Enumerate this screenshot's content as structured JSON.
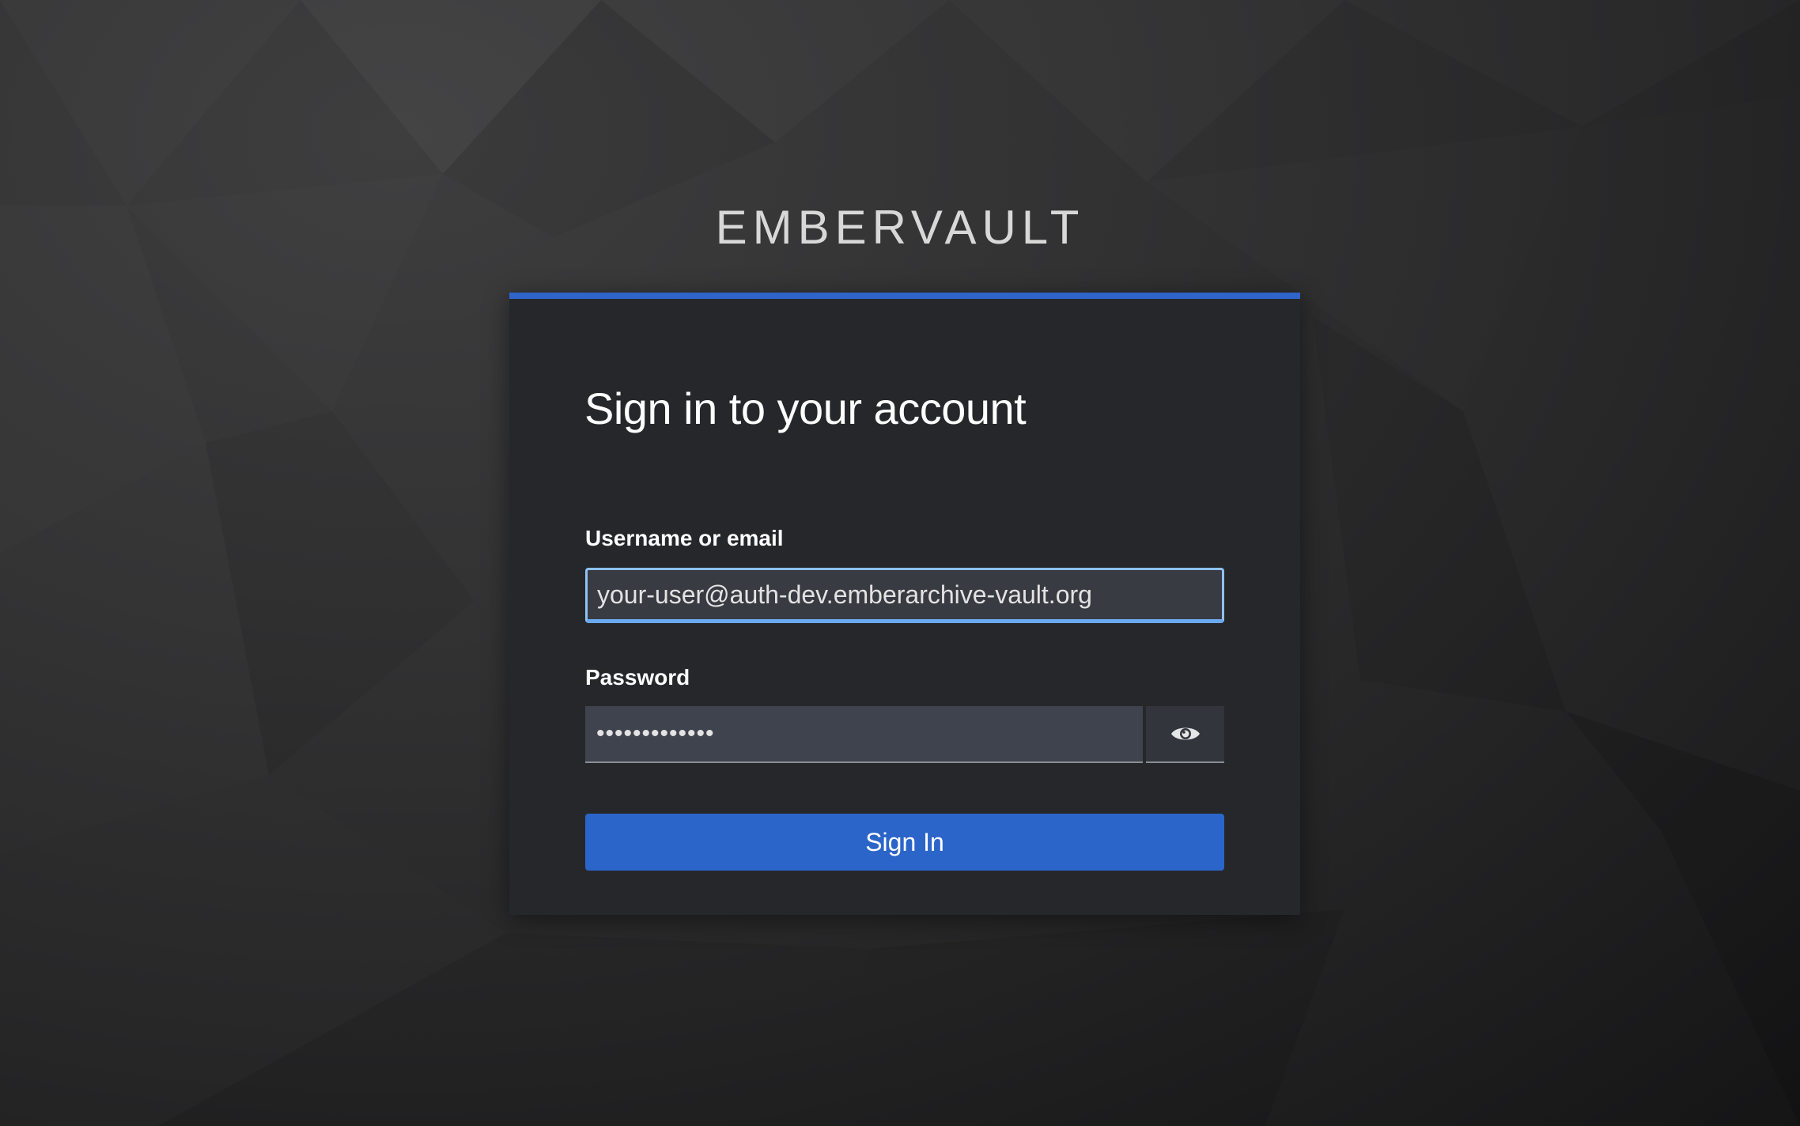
{
  "brand": {
    "name": "EMBERVAULT"
  },
  "login": {
    "title": "Sign in to your account",
    "username_label": "Username or email",
    "username_value": "your-user@auth-dev.emberarchive-vault.org",
    "password_label": "Password",
    "password_value": "•••••••••••••",
    "show_password_icon": "eye-icon",
    "submit_label": "Sign In"
  },
  "colors": {
    "accent": "#2b65c9",
    "card_background": "#26272b",
    "focus_border": "#8ec1f5"
  }
}
